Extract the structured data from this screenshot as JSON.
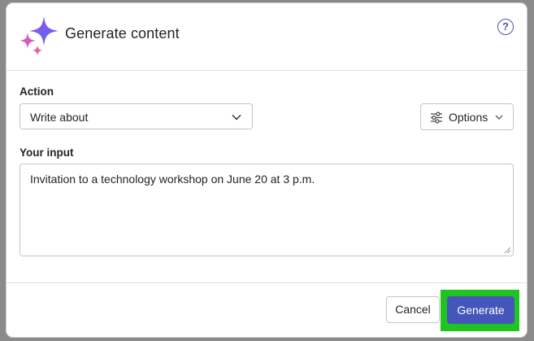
{
  "dialog": {
    "title": "Generate content",
    "help_icon": "question-circle-icon",
    "logo_icon": "sparkle-icon"
  },
  "action": {
    "label": "Action",
    "selected": "Write about"
  },
  "options_button": {
    "label": "Options",
    "icon": "sliders-icon"
  },
  "input": {
    "label": "Your input",
    "value": "Invitation to a technology workshop on June 20 at 3 p.m."
  },
  "footer": {
    "cancel_label": "Cancel",
    "generate_label": "Generate"
  },
  "colors": {
    "accent": "#4456b9",
    "highlight": "#1fc41f"
  }
}
